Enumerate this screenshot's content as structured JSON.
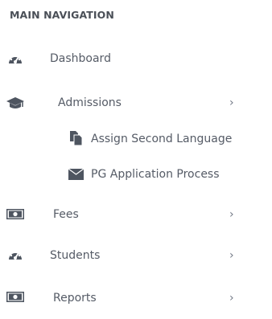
{
  "sidebar": {
    "header": "MAIN NAVIGATION",
    "items": [
      {
        "label": "Dashboard",
        "icon": "dashboard-icon"
      },
      {
        "label": "Admissions",
        "icon": "graduation-cap-icon",
        "chevron": "›"
      },
      {
        "label": "Assign Second Language",
        "icon": "file-copy-icon"
      },
      {
        "label": "PG Application Process",
        "icon": "envelope-icon"
      },
      {
        "label": "Fees",
        "icon": "money-icon",
        "chevron": "›"
      },
      {
        "label": "Students",
        "icon": "dashboard-icon",
        "chevron": "›"
      },
      {
        "label": "Reports",
        "icon": "money-icon",
        "chevron": "›"
      }
    ]
  },
  "colors": {
    "text": "#555b66",
    "header": "#4a4f57",
    "icon": "#4e5560"
  }
}
